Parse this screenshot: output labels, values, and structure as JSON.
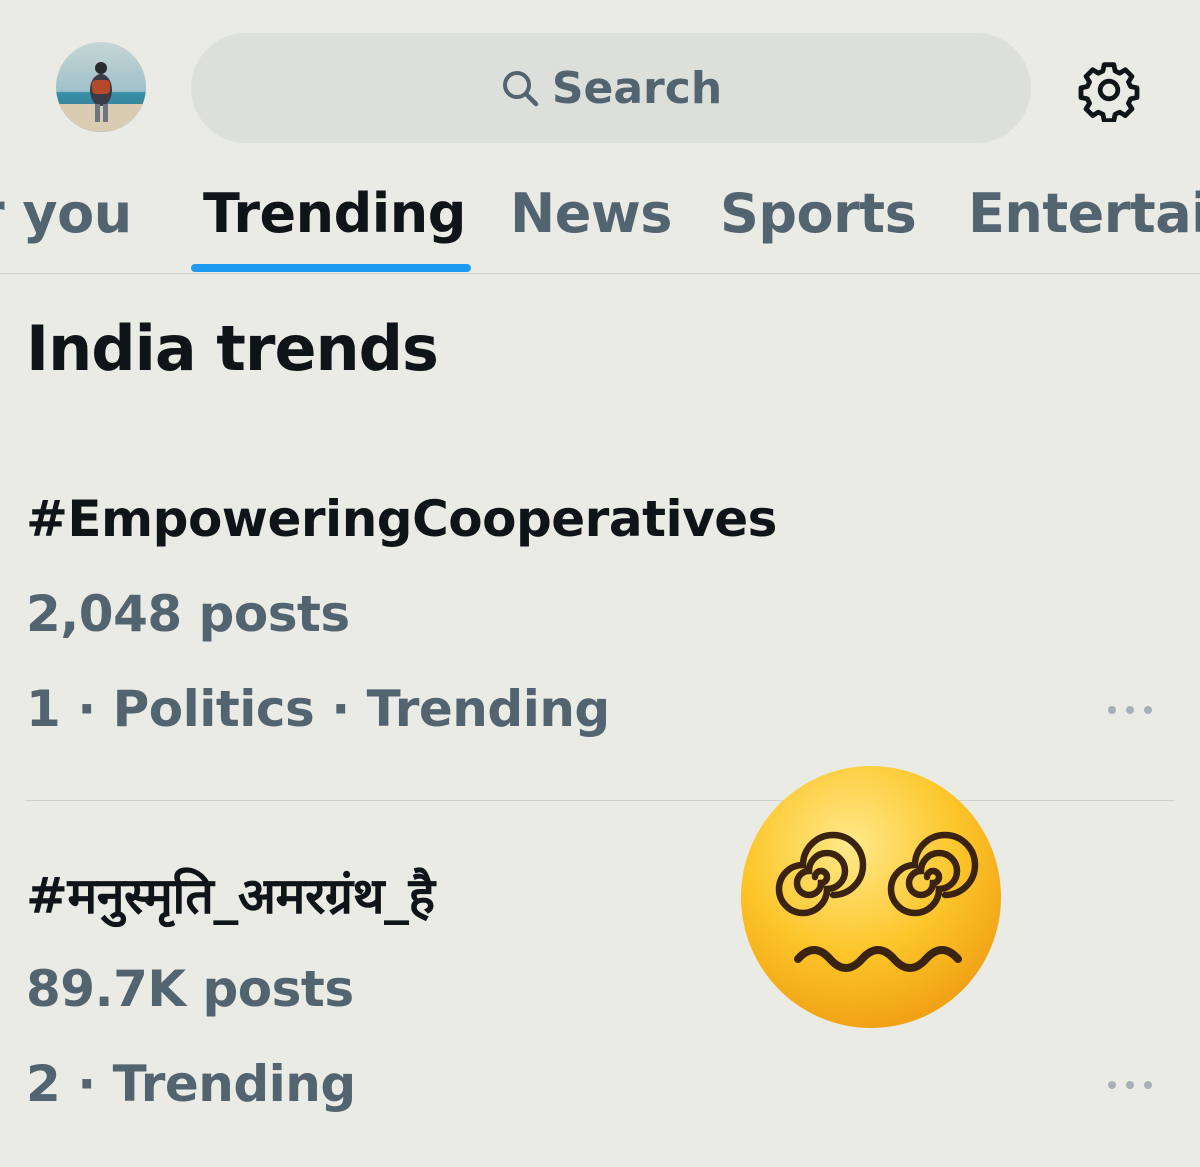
{
  "header": {
    "avatar_icon": "profile-avatar",
    "search_placeholder": "Search",
    "settings_icon": "gear-icon"
  },
  "tabs": [
    {
      "label": "r you"
    },
    {
      "label": "Trending",
      "active": true
    },
    {
      "label": "News"
    },
    {
      "label": "Sports"
    },
    {
      "label": "Entertai"
    }
  ],
  "section": {
    "title": "India trends"
  },
  "trends": [
    {
      "name": "#EmpoweringCooperatives",
      "count": "2,048 posts",
      "meta": "1 · Politics · Trending"
    },
    {
      "name": "#मनुस्मृति_अमरग्रंथ_है",
      "count": "89.7K posts",
      "meta": "2 · Trending"
    }
  ],
  "overlay": {
    "emoji": "face-with-spiral-eyes-emoji"
  },
  "colors": {
    "accent": "#1d9bf0",
    "text": "#0f1419",
    "muted": "#536471",
    "background": "#ebebe5"
  }
}
